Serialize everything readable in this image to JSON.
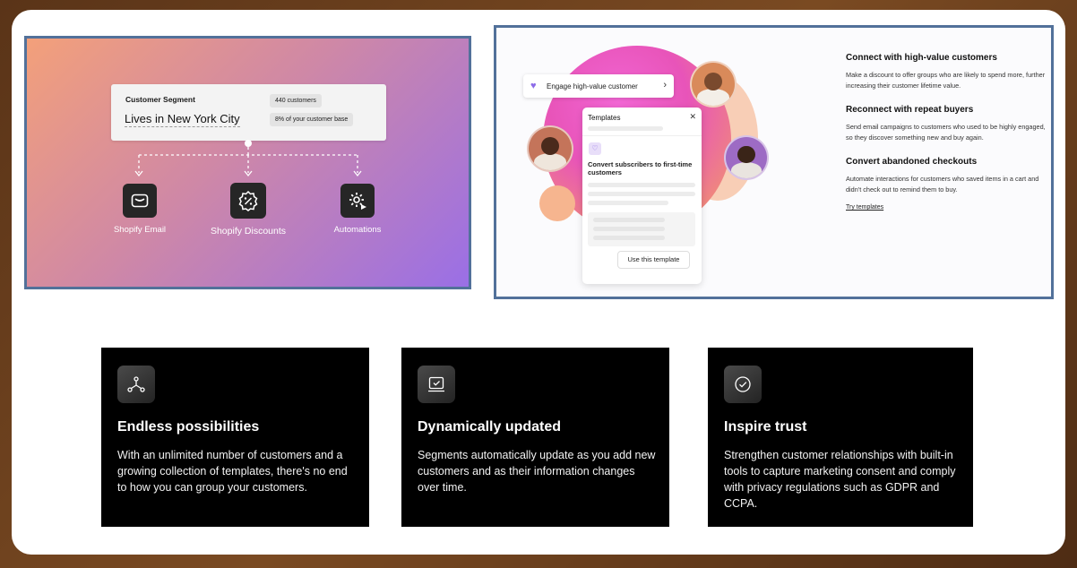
{
  "left_panel": {
    "segment_card": {
      "label": "Customer Segment",
      "title": "Lives in New York City",
      "customers_pill": "440 customers",
      "base_pill": "8% of your customer base"
    },
    "tools": [
      {
        "label": "Shopify Email",
        "icon": "mail-icon"
      },
      {
        "label": "Shopify Discounts",
        "icon": "discount-badge-icon"
      },
      {
        "label": "Automations",
        "icon": "gear-play-icon"
      }
    ]
  },
  "right_panel": {
    "engage_pill": "Engage high-value customer",
    "templates_card": {
      "title": "Templates",
      "template_name": "Convert subscribers to first-time customers",
      "button": "Use this template"
    },
    "features": [
      {
        "title": "Connect with high-value customers",
        "desc": "Make a discount to offer groups who are likely to spend more, further increasing their customer lifetime value."
      },
      {
        "title": "Reconnect with repeat buyers",
        "desc": "Send email campaigns to customers who used to be highly engaged, so they discover something new and buy again."
      },
      {
        "title": "Convert abandoned checkouts",
        "desc": "Automate interactions for customers who saved items in a cart and didn't check out to remind them to buy."
      }
    ],
    "link": "Try templates"
  },
  "cards": [
    {
      "icon": "network-nodes-icon",
      "title": "Endless possibilities",
      "desc": "With an unlimited number of customers and a growing collection of templates, there's no end to how you can group your customers."
    },
    {
      "icon": "laptop-check-icon",
      "title": "Dynamically updated",
      "desc": "Segments automatically update as you add new customers and as their information changes over time."
    },
    {
      "icon": "check-circle-icon",
      "title": "Inspire trust",
      "desc": "Strengthen customer relationships with built-in tools to capture marketing consent and comply with privacy regulations such as GDPR and CCPA."
    }
  ],
  "colors": {
    "frame_border": "#52719a",
    "accent_purple": "#8d6ce8",
    "card_bg": "#000000"
  }
}
